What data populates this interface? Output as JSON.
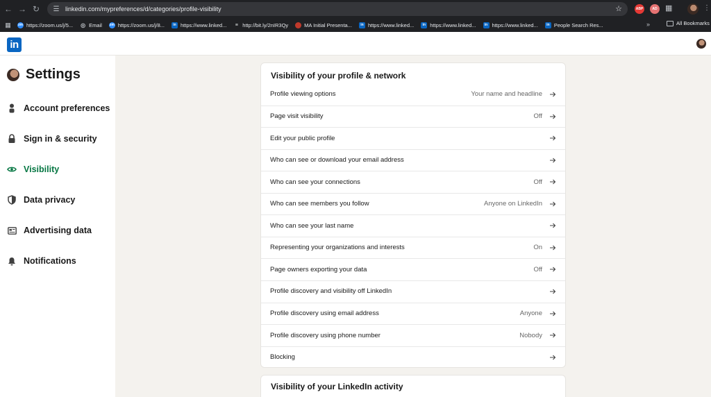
{
  "browser": {
    "url": "linkedin.com/mypreferences/d/categories/profile-visibility",
    "ext_abp": "ABP",
    "ext_2": "AD",
    "bookmarks": [
      {
        "icon": "zoom",
        "label": "https://zoom.us/j/5..."
      },
      {
        "icon": "globe",
        "label": "Email"
      },
      {
        "icon": "zoom",
        "label": "https://zoom.us/j/8..."
      },
      {
        "icon": "linkedin",
        "label": "https://www.linked..."
      },
      {
        "icon": "bitly",
        "label": "http://bit.ly/2nIR3Qy"
      },
      {
        "icon": "ma",
        "label": "MA Initial Presenta..."
      },
      {
        "icon": "linkedin",
        "label": "https://www.linked..."
      },
      {
        "icon": "linkedin",
        "label": "https://www.linked..."
      },
      {
        "icon": "linkedin",
        "label": "https://www.linked..."
      },
      {
        "icon": "linkedin",
        "label": "People Search Res..."
      }
    ],
    "bookmarks_more": "»",
    "all_bookmarks": "All Bookmarks"
  },
  "header": {
    "logo_text": "in"
  },
  "sidebar": {
    "title": "Settings",
    "items": [
      {
        "label": "Account preferences",
        "icon": "person-icon",
        "active": false
      },
      {
        "label": "Sign in & security",
        "icon": "lock-icon",
        "active": false
      },
      {
        "label": "Visibility",
        "icon": "eye-icon",
        "active": true
      },
      {
        "label": "Data privacy",
        "icon": "shield-icon",
        "active": false
      },
      {
        "label": "Advertising data",
        "icon": "newspaper-icon",
        "active": false
      },
      {
        "label": "Notifications",
        "icon": "bell-icon",
        "active": false
      }
    ]
  },
  "main": {
    "section_title": "Visibility of your profile & network",
    "rows": [
      {
        "label": "Profile viewing options",
        "value": "Your name and headline"
      },
      {
        "label": "Page visit visibility",
        "value": "Off"
      },
      {
        "label": "Edit your public profile",
        "value": ""
      },
      {
        "label": "Who can see or download your email address",
        "value": ""
      },
      {
        "label": "Who can see your connections",
        "value": "Off"
      },
      {
        "label": "Who can see members you follow",
        "value": "Anyone on LinkedIn"
      },
      {
        "label": "Who can see your last name",
        "value": ""
      },
      {
        "label": "Representing your organizations and interests",
        "value": "On"
      },
      {
        "label": "Page owners exporting your data",
        "value": "Off"
      },
      {
        "label": "Profile discovery and visibility off LinkedIn",
        "value": ""
      },
      {
        "label": "Profile discovery using email address",
        "value": "Anyone"
      },
      {
        "label": "Profile discovery using phone number",
        "value": "Nobody"
      },
      {
        "label": "Blocking",
        "value": ""
      }
    ],
    "next_section_title": "Visibility of your LinkedIn activity"
  },
  "colors": {
    "accent_green": "#057642",
    "linkedin_blue": "#0a66c2",
    "page_background": "#f4f2ee"
  }
}
